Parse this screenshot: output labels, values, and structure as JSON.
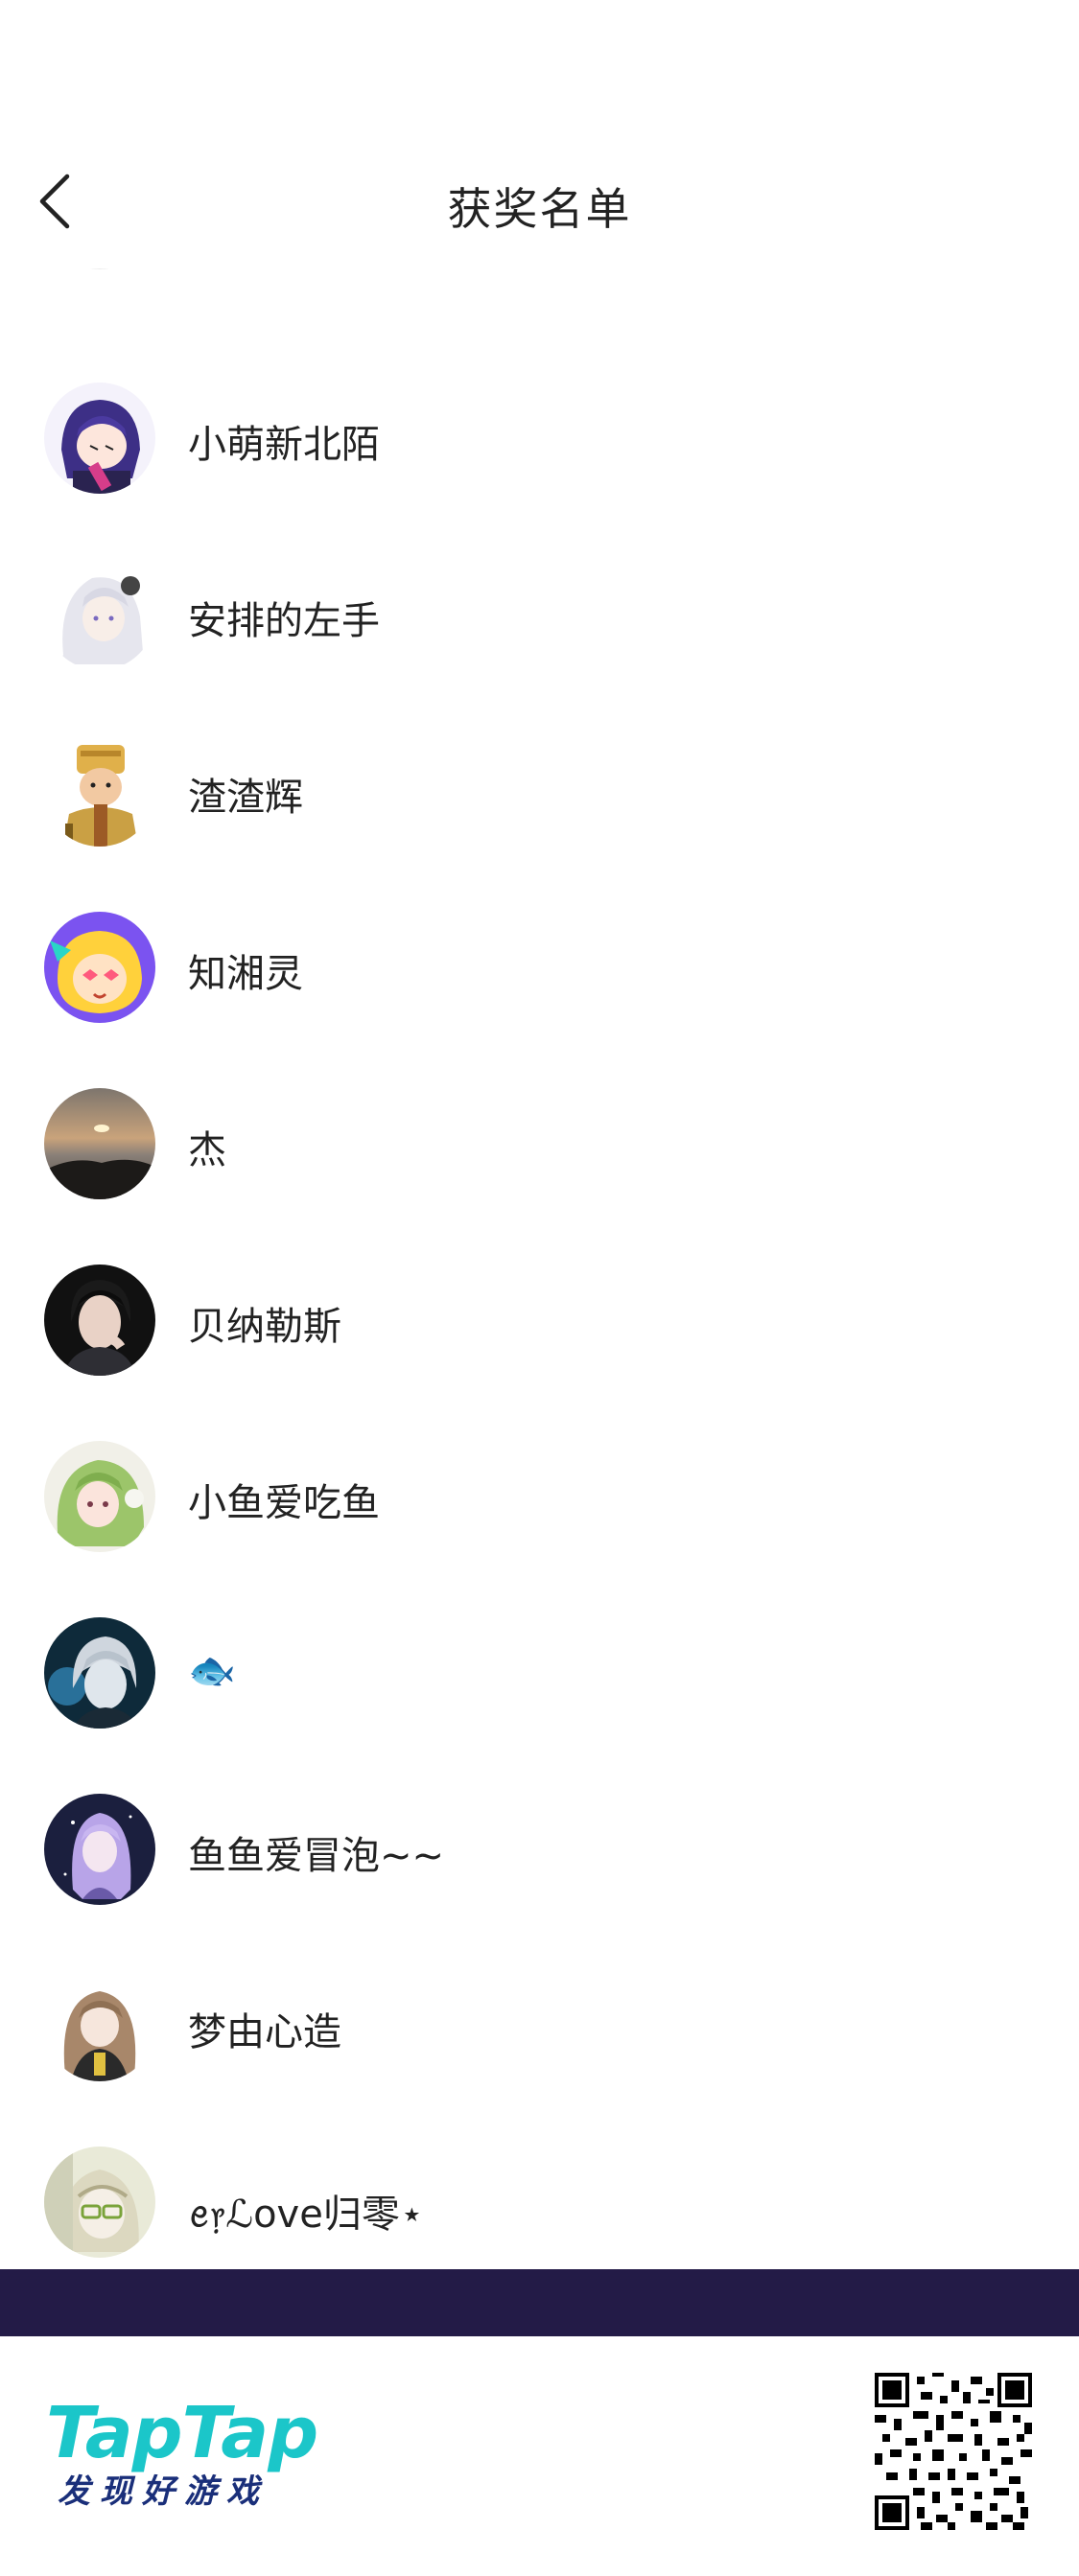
{
  "header": {
    "title": "获奖名单",
    "back_icon": "chevron-left-icon"
  },
  "winners": [
    {
      "name": "",
      "avatar": "partial-avatar"
    },
    {
      "name": "小萌新北陌",
      "avatar": "anime-purple-hair"
    },
    {
      "name": "安排的左手",
      "avatar": "anime-white-hair"
    },
    {
      "name": "渣渣辉",
      "avatar": "cartoon-emperor"
    },
    {
      "name": "知湘灵",
      "avatar": "cartoon-yellow-purple"
    },
    {
      "name": "杰",
      "avatar": "sunset-landscape"
    },
    {
      "name": "贝纳勒斯",
      "avatar": "portrait-dark"
    },
    {
      "name": "小鱼爱吃鱼",
      "avatar": "anime-green-hair"
    },
    {
      "name": "🐟",
      "avatar": "anime-silver-hair"
    },
    {
      "name": "鱼鱼爱冒泡~~",
      "avatar": "anime-violet-hair"
    },
    {
      "name": "梦由心造",
      "avatar": "anime-brown-hair"
    },
    {
      "name": "ꫀ᥅ℒove归零⋆",
      "avatar": "anime-green-glasses"
    }
  ],
  "footer": {
    "logo": "TapTap",
    "slogan": "发现好游戏",
    "qr_icon": "qr-code-icon"
  },
  "colors": {
    "bar": "#231b47",
    "brand": "#1bc6c9",
    "slogan": "#1a2f7a"
  }
}
